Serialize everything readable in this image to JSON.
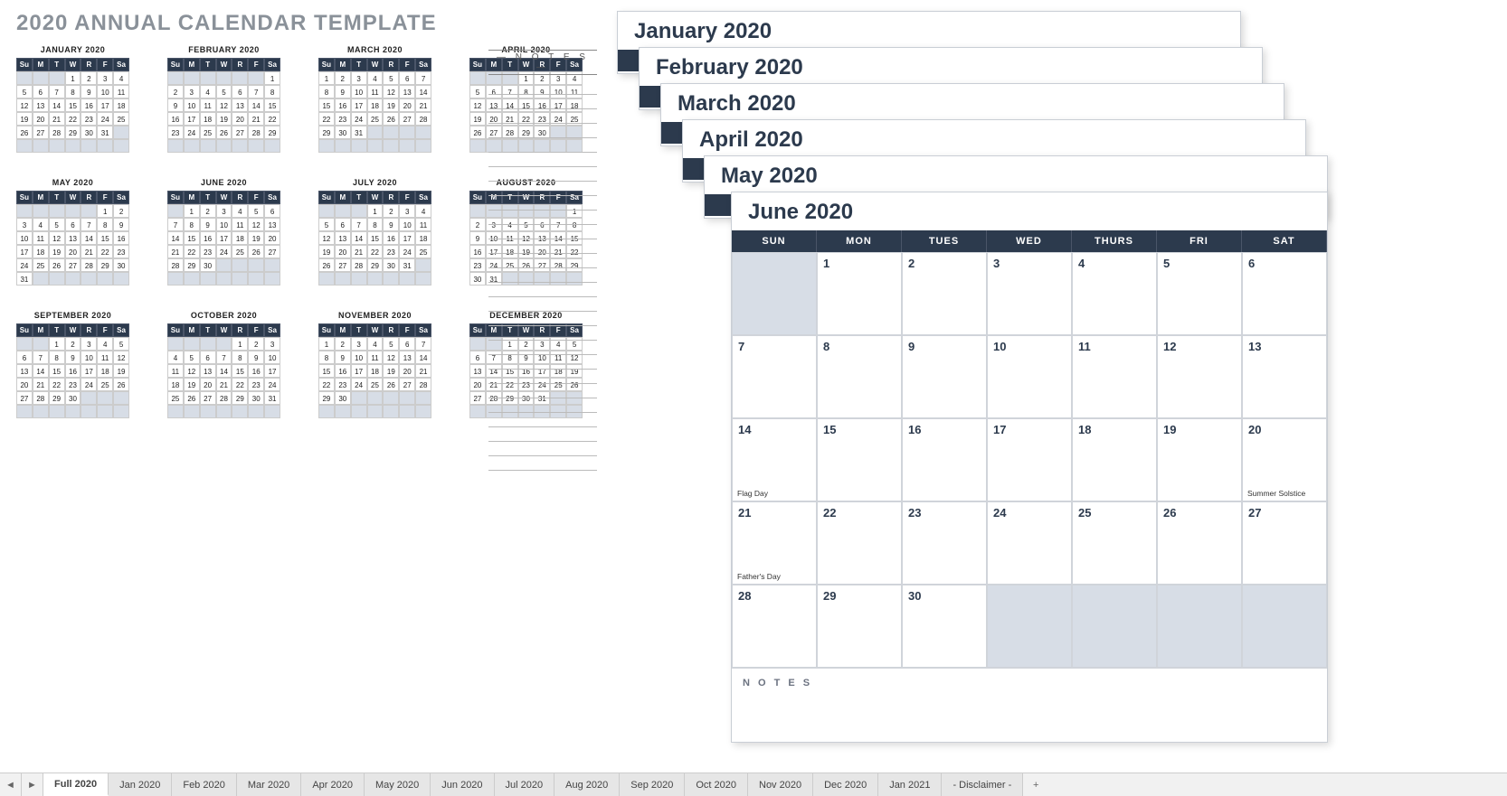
{
  "title": "2020 ANNUAL CALENDAR TEMPLATE",
  "dayShort": [
    "Su",
    "M",
    "T",
    "W",
    "R",
    "F",
    "Sa"
  ],
  "dayFull": [
    "SUN",
    "MON",
    "TUES",
    "WED",
    "THURS",
    "FRI",
    "SAT"
  ],
  "notesLabel": "— N O T E S —",
  "sheetNotesLabel": "N O T E S",
  "months": [
    {
      "name": "JANUARY 2020",
      "start": 3,
      "days": 31
    },
    {
      "name": "FEBRUARY 2020",
      "start": 6,
      "days": 29
    },
    {
      "name": "MARCH 2020",
      "start": 0,
      "days": 31
    },
    {
      "name": "APRIL 2020",
      "start": 3,
      "days": 30
    },
    {
      "name": "MAY 2020",
      "start": 5,
      "days": 31
    },
    {
      "name": "JUNE 2020",
      "start": 1,
      "days": 30
    },
    {
      "name": "JULY 2020",
      "start": 3,
      "days": 31
    },
    {
      "name": "AUGUST 2020",
      "start": 6,
      "days": 31
    },
    {
      "name": "SEPTEMBER 2020",
      "start": 2,
      "days": 30
    },
    {
      "name": "OCTOBER 2020",
      "start": 4,
      "days": 31
    },
    {
      "name": "NOVEMBER 2020",
      "start": 0,
      "days": 30
    },
    {
      "name": "DECEMBER 2020",
      "start": 2,
      "days": 31
    }
  ],
  "stackTitles": [
    "January 2020",
    "February 2020",
    "March 2020",
    "April 2020",
    "May 2020",
    "June 2020"
  ],
  "june": {
    "title": "June 2020",
    "start": 1,
    "days": 30,
    "events": [
      {
        "day": 14,
        "text": "Flag Day"
      },
      {
        "day": 20,
        "text": "Summer Solstice"
      },
      {
        "day": 21,
        "text": "Father's Day"
      }
    ]
  },
  "tabs": [
    "Full 2020",
    "Jan 2020",
    "Feb 2020",
    "Mar 2020",
    "Apr 2020",
    "May 2020",
    "Jun 2020",
    "Jul 2020",
    "Aug 2020",
    "Sep 2020",
    "Oct 2020",
    "Nov 2020",
    "Dec 2020",
    "Jan 2021",
    "- Disclaimer -"
  ],
  "activeTab": 0
}
